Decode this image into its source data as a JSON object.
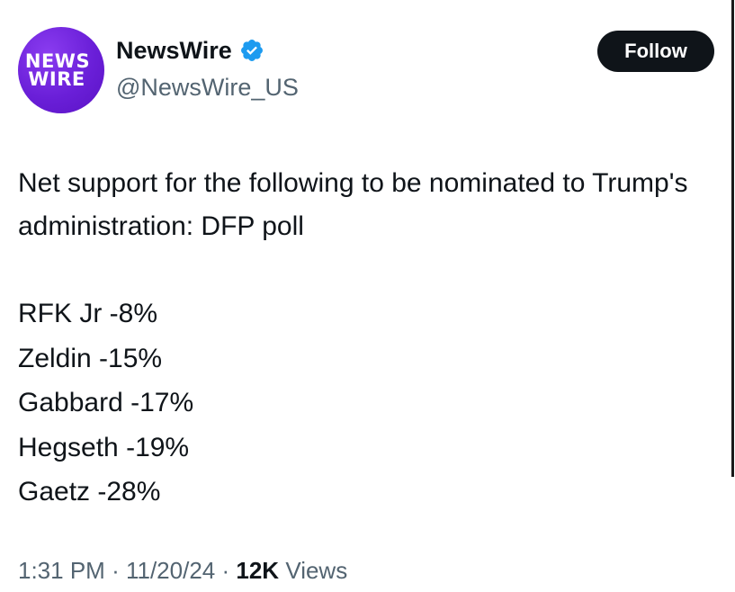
{
  "account": {
    "avatar_line1": "NEWS",
    "avatar_line2": "WIRE",
    "display_name": "NewsWire",
    "handle": "@NewsWire_US",
    "verified": true
  },
  "follow_button": {
    "label": "Follow"
  },
  "tweet": {
    "headline": "Net support for the following to be nominated to Trump's administration: DFP poll",
    "lines": [
      "RFK Jr -8%",
      "Zeldin -15%",
      "Gabbard -17%",
      "Hegseth -19%",
      "Gaetz -28%"
    ]
  },
  "meta": {
    "time": "1:31 PM",
    "date": "11/20/24",
    "views_count": "12K",
    "views_label": "Views",
    "separator": "·"
  },
  "colors": {
    "avatar_purple": "#6a1fd8",
    "verified_blue": "#1d9bf0",
    "text": "#0f1419",
    "secondary_text": "#536471",
    "button_bg": "#0f1419"
  }
}
